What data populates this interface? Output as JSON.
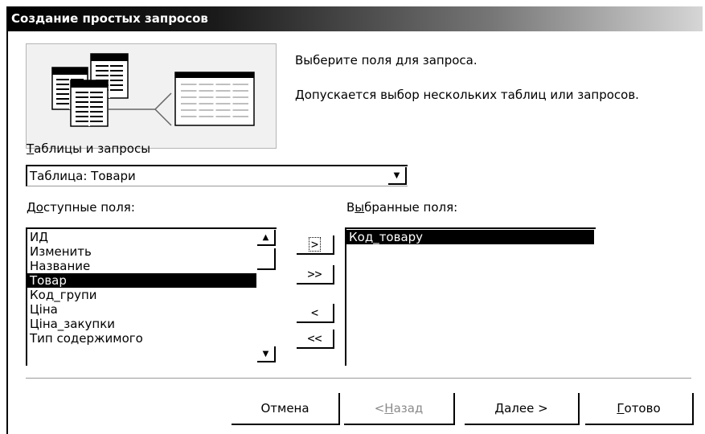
{
  "window": {
    "title": "Создание простых запросов"
  },
  "info": {
    "line1": "Выберите поля для запроса.",
    "line2": "Допускается выбор нескольких таблиц или запросов."
  },
  "tables": {
    "label_accel": "Т",
    "label_rest": "аблицы и запросы",
    "selected": "Таблица: Товари"
  },
  "available": {
    "label_pre": "Д",
    "label_accel": "о",
    "label_rest": "ступные поля:",
    "items": [
      "ИД",
      "Изменить",
      "Название",
      "Товар",
      "Код_групи",
      "Ціна",
      "Ціна_закупки",
      "Тип содержимого"
    ],
    "selected_index": 3
  },
  "selected": {
    "label_pre": "В",
    "label_accel": "ы",
    "label_rest": "бранные поля:",
    "items": [
      "Код_товару"
    ],
    "selected_index": 0
  },
  "move_buttons": {
    "add": ">",
    "add_all": ">>",
    "remove": "<",
    "remove_all": "<<"
  },
  "footer": {
    "cancel": "Отмена",
    "back_pre": "< ",
    "back_accel": "Н",
    "back_rest": "азад",
    "next_accel": "Д",
    "next_rest": "алее >",
    "finish_accel": "Г",
    "finish_rest": "отово"
  },
  "icons": {
    "dropdown": "dropdown-arrow-icon",
    "scroll_up": "scroll-up-arrow-icon",
    "scroll_down": "scroll-down-arrow-icon",
    "wizard": "table-to-query-wizard-illustration"
  }
}
